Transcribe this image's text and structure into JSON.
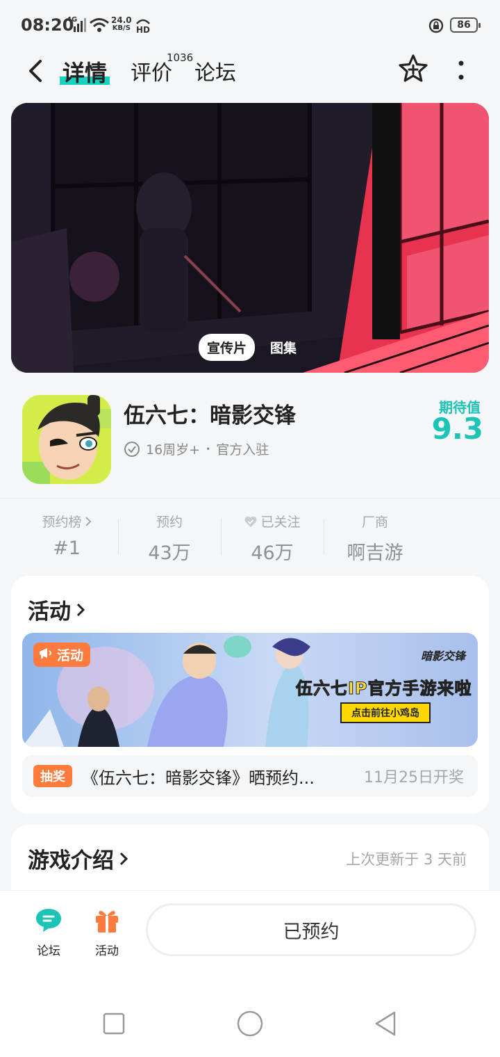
{
  "status_bar": {
    "time": "08:20",
    "network": "4G",
    "speed_value": "24.0",
    "speed_unit": "KB/S",
    "hd": "HD",
    "battery": "86"
  },
  "nav": {
    "tabs": [
      {
        "label": "详情",
        "active": true
      },
      {
        "label": "评价"
      },
      {
        "label": "论坛"
      }
    ],
    "review_count": "1036"
  },
  "hero": {
    "tabs": [
      {
        "label": "宣传片",
        "active": true
      },
      {
        "label": "图集"
      }
    ]
  },
  "app": {
    "name": "伍六七：暗影交锋",
    "age_rating": "16周岁+",
    "separator": "•",
    "official": "官方入驻",
    "expectation_label": "期待值",
    "expectation_value": "9.3"
  },
  "stats": [
    {
      "label": "预约榜",
      "value": "#1",
      "has_chevron": true
    },
    {
      "label": "预约",
      "value": "43万"
    },
    {
      "label": "已关注",
      "value": "46万",
      "has_heart": true
    },
    {
      "label": "厂商",
      "value": "啊吉游"
    }
  ],
  "activity": {
    "title": "活动",
    "banner": {
      "tag": "活动",
      "logo": "暗影交锋",
      "headline": "伍六七IP官方手游来啦",
      "button": "点击前往小鸡岛"
    },
    "lottery": {
      "tag": "抽奖",
      "text": "《伍六七：暗影交锋》晒预约...",
      "date": "11月25日开奖"
    }
  },
  "intro": {
    "title": "游戏介绍",
    "updated": "上次更新于 3 天前"
  },
  "bottom_bar": {
    "forum_label": "论坛",
    "activity_label": "活动",
    "reserved_label": "已预约"
  },
  "colors": {
    "accent": "#1bc4b4",
    "orange": "#ff7a3d",
    "hero_red": "#e8334f"
  }
}
